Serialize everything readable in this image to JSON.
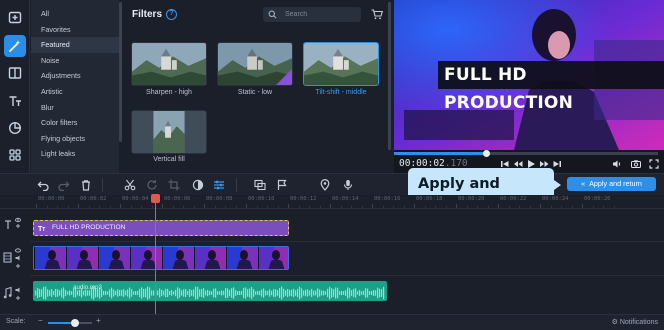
{
  "rail": {
    "items": [
      {
        "name": "import-icon",
        "active": false
      },
      {
        "name": "filters-icon",
        "active": true
      },
      {
        "name": "transitions-icon",
        "active": false
      },
      {
        "name": "titles-icon",
        "active": false
      },
      {
        "name": "stickers-icon",
        "active": false
      },
      {
        "name": "more-tools-icon",
        "active": false
      }
    ]
  },
  "categories": [
    {
      "label": "All",
      "active": false
    },
    {
      "label": "Favorites",
      "active": false
    },
    {
      "label": "Featured",
      "active": true
    },
    {
      "label": "Noise",
      "active": false
    },
    {
      "label": "Adjustments",
      "active": false
    },
    {
      "label": "Artistic",
      "active": false
    },
    {
      "label": "Blur",
      "active": false
    },
    {
      "label": "Color filters",
      "active": false
    },
    {
      "label": "Flying objects",
      "active": false
    },
    {
      "label": "Light leaks",
      "active": false
    }
  ],
  "filters": {
    "title": "Filters",
    "help": "?",
    "search_placeholder": "Search",
    "items": [
      {
        "label": "Sharpen - high",
        "selected": false,
        "badge": false,
        "tone": "sharp"
      },
      {
        "label": "Static - low",
        "selected": false,
        "badge": true,
        "tone": "static"
      },
      {
        "label": "Tilt-shift - middle",
        "selected": true,
        "badge": false,
        "tone": "tilt"
      },
      {
        "label": "Vertical fill",
        "selected": false,
        "badge": false,
        "tone": "vertical"
      }
    ]
  },
  "player": {
    "overlay_title": "FULL HD PRODUCTION",
    "timecode": "00:00:02",
    "timecode_frames": ".170",
    "progress": 0.35
  },
  "tooltip": {
    "text": "Apply and return"
  },
  "apply_button": {
    "label": "Apply and return",
    "icon": "chevrons-left-icon"
  },
  "ruler": [
    "00:00:00",
    "00:00:02",
    "00:00:04",
    "00:00:06",
    "00:00:08",
    "00:00:10",
    "00:00:12",
    "00:00:14",
    "00:00:16",
    "00:00:18",
    "00:00:20",
    "00:00:22",
    "00:00:24",
    "00:00:26"
  ],
  "tracks": {
    "title_clip": "FULL HD PRODUCTION",
    "audio_clip": "audio.mp3"
  },
  "bottom": {
    "scale_label": "Scale:",
    "zoom_minus": "−",
    "zoom_plus": "+",
    "zoom_level": 0.62,
    "notifications": "Notifications"
  },
  "colors": {
    "accent": "#2d8fe8",
    "title_clip": "#7a4fbd",
    "audio_clip": "#1f9e88",
    "playhead": "#e4574d",
    "tooltip": "#c6e7fb"
  }
}
